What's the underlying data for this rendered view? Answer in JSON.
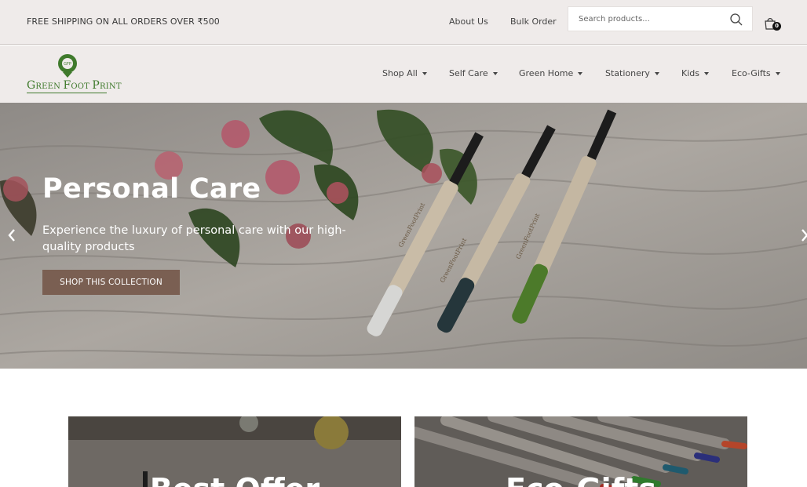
{
  "topbar": {
    "shipping_text": "FREE SHIPPING ON ALL ORDERS OVER ₹500",
    "links": [
      "About Us",
      "Bulk Order"
    ],
    "search_placeholder": "Search products...",
    "cart_count": "0"
  },
  "logo": {
    "emblem_text": "GFP",
    "text_parts": [
      {
        "cap": "G",
        "rest": "REEN "
      },
      {
        "cap": "F",
        "rest": "OOT "
      },
      {
        "cap": "P",
        "rest": "RINT"
      }
    ]
  },
  "nav": {
    "items": [
      "Shop All",
      "Self Care",
      "Green Home",
      "Stationery",
      "Kids",
      "Eco-Gifts"
    ]
  },
  "hero": {
    "title": "Personal Care",
    "subtitle": "Experience the luxury of personal care with our high-quality products",
    "button": "SHOP THIS COLLECTION",
    "brush_text": "GreenFootPrint"
  },
  "tiles": [
    {
      "title": "Best Offer"
    },
    {
      "title": "Eco-Gifts"
    }
  ],
  "colors": {
    "header_bg": "#efebea",
    "button_bg": "#7a5f52",
    "logo_green": "#3f7a2c"
  }
}
